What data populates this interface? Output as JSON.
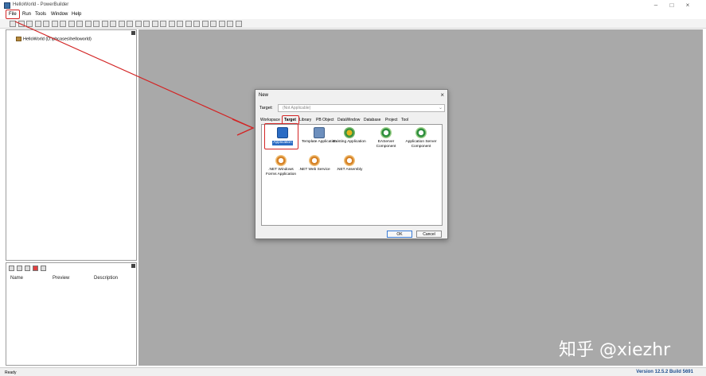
{
  "window": {
    "title": "HelloWorld - PowerBuilder",
    "controls": {
      "minimize": "–",
      "maximize": "□",
      "close": "×"
    }
  },
  "menu": {
    "items": [
      "File",
      "Run",
      "Tools",
      "Window",
      "Help"
    ]
  },
  "toolbar": {
    "button_count": 28
  },
  "tree": {
    "root_label": "HelloWorld (D:\\pbcases\\helloworld)"
  },
  "bottom_panel": {
    "columns": [
      "Name",
      "Preview",
      "Description"
    ]
  },
  "dialog": {
    "title": "New",
    "target_label": "Target:",
    "target_value": "(Not Applicable)",
    "tabs": [
      "Workspace",
      "Target",
      "Library",
      "PB Object",
      "DataWindow",
      "Database",
      "Project",
      "Tool"
    ],
    "active_tab": "Target",
    "items": [
      {
        "label": "Application",
        "icon": "application-icon",
        "selected": true
      },
      {
        "label": "Template Application",
        "icon": "template-application-icon",
        "selected": false
      },
      {
        "label": "Existing Application",
        "icon": "existing-application-icon",
        "selected": false
      },
      {
        "label": "EAServer Component",
        "icon": "easerver-component-icon",
        "selected": false
      },
      {
        "label": "Application Server Component",
        "icon": "application-server-component-icon",
        "selected": false
      },
      {
        "label": ".NET Windows Forms Application",
        "icon": "net-windows-forms-icon",
        "selected": false
      },
      {
        "label": ".NET Web Service",
        "icon": "net-web-service-icon",
        "selected": false
      },
      {
        "label": ".NET Assembly",
        "icon": "net-assembly-icon",
        "selected": false
      }
    ],
    "ok_label": "OK",
    "cancel_label": "Cancel"
  },
  "status": {
    "left": "Ready",
    "version": "Version 12.5.2 Build 5691"
  },
  "watermark": "知乎 @xiezhr",
  "colors": {
    "workspace": "#a9a9a9",
    "annotation": "#d32424",
    "selection": "#2b6cc4",
    "version_text": "#1f4f8f"
  }
}
